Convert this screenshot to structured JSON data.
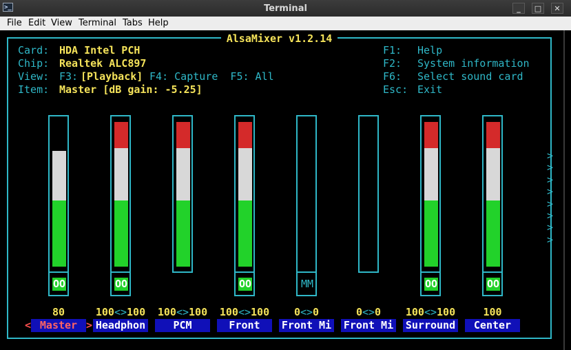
{
  "window": {
    "title": "Terminal",
    "icon": "terminal-icon",
    "buttons": {
      "minimize": "_",
      "maximize": "□",
      "close": "✕"
    }
  },
  "menubar": [
    "File",
    "Edit",
    "View",
    "Terminal",
    "Tabs",
    "Help"
  ],
  "alsamixer": {
    "title": "AlsaMixer v1.2.14",
    "card_label": "Card:",
    "card": "HDA Intel PCH",
    "chip_label": "Chip:",
    "chip": "Realtek ALC897",
    "view_label": "View:",
    "view_f3": "F3:",
    "view_playback": "[Playback]",
    "view_rest": " F4: Capture  F5: All",
    "item_label": "Item:",
    "item": "Master [dB gain: -5.25]",
    "help": [
      {
        "key": "F1:",
        "label": "Help"
      },
      {
        "key": "F2:",
        "label": "System information"
      },
      {
        "key": "F6:",
        "label": "Select sound card"
      },
      {
        "key": "Esc:",
        "label": "Exit"
      }
    ],
    "more_arrow": ">",
    "channels": [
      {
        "name": "Master",
        "left": "80",
        "sep": "",
        "right": "",
        "level": 0.8,
        "mute": "OO",
        "mute_on": true,
        "has_bar": true,
        "selected": true
      },
      {
        "name": "Headphon",
        "left": "100",
        "sep": "<>",
        "right": "100",
        "level": 1.0,
        "mute": "OO",
        "mute_on": true,
        "has_bar": true,
        "selected": false
      },
      {
        "name": "PCM",
        "left": "100",
        "sep": "<>",
        "right": "100",
        "level": 1.0,
        "mute": "",
        "mute_on": false,
        "has_bar": true,
        "selected": false
      },
      {
        "name": "Front",
        "left": "100",
        "sep": "<>",
        "right": "100",
        "level": 1.0,
        "mute": "OO",
        "mute_on": true,
        "has_bar": true,
        "selected": false
      },
      {
        "name": "Front Mi",
        "left": "0",
        "sep": "<>",
        "right": "0",
        "level": 0.0,
        "mute": "MM",
        "mute_on": false,
        "has_bar": false,
        "selected": false
      },
      {
        "name": "Front Mi",
        "left": "0",
        "sep": "<>",
        "right": "0",
        "level": 0.0,
        "mute": "",
        "mute_on": false,
        "has_bar": false,
        "selected": false
      },
      {
        "name": "Surround",
        "left": "100",
        "sep": "<>",
        "right": "100",
        "level": 1.0,
        "mute": "OO",
        "mute_on": true,
        "has_bar": true,
        "selected": false
      },
      {
        "name": "Center",
        "left": "100",
        "sep": "",
        "right": "",
        "level": 1.0,
        "mute": "OO",
        "mute_on": true,
        "has_bar": true,
        "selected": false
      }
    ],
    "selection_marks": {
      "left": "<",
      "right": ">"
    }
  },
  "colors": {
    "frame": "#2fb8c8",
    "label": "#2fb8c8",
    "value": "#f5e35a",
    "bar_red": "#d42a2a",
    "bar_white": "#d8d8d8",
    "bar_green": "#22d22a",
    "name_bg": "#1010b8",
    "selected_name": "#ff6464"
  }
}
